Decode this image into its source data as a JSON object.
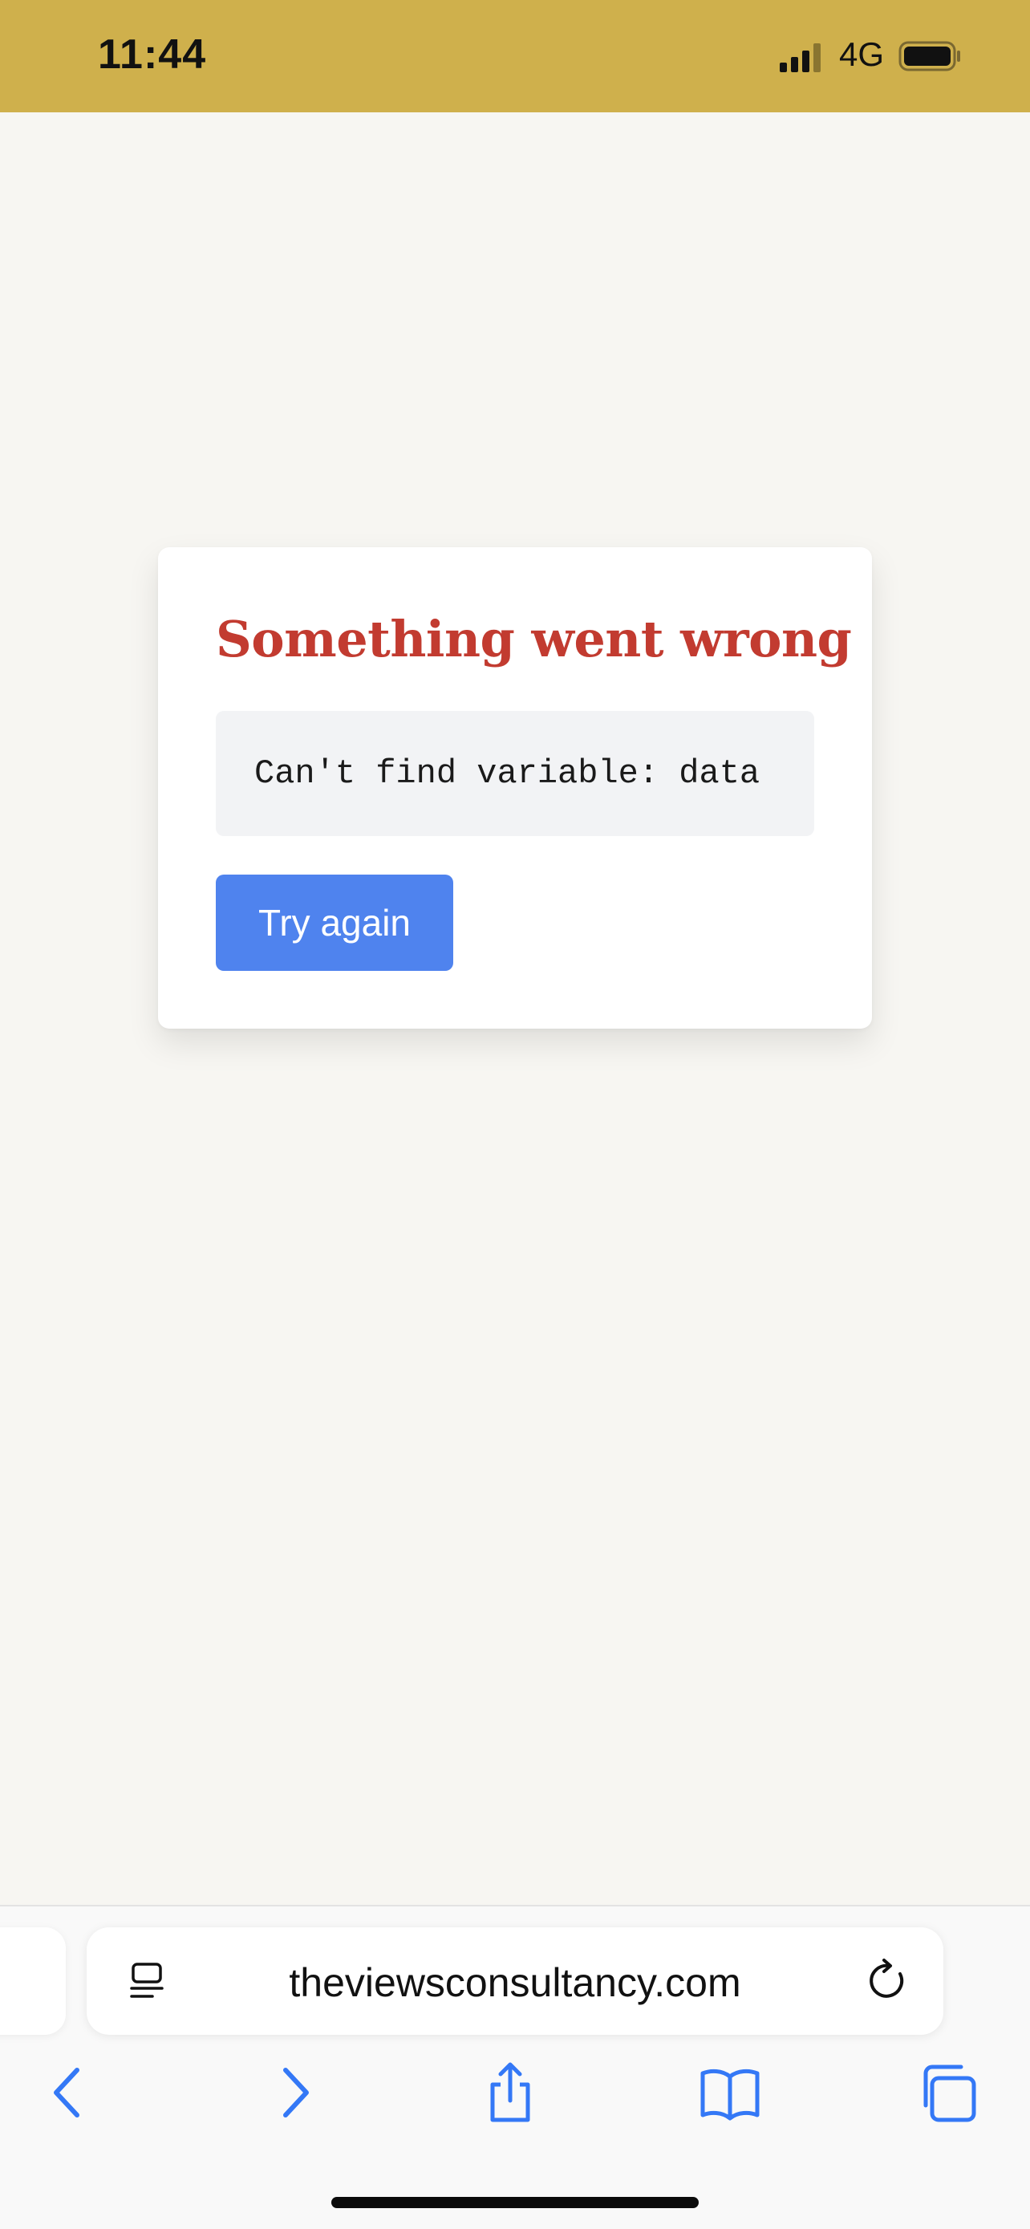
{
  "status_bar": {
    "time": "11:44",
    "network": "4G",
    "background_color": "#cfb04c"
  },
  "error_card": {
    "title": "Something went wrong",
    "message": "Can't find variable: data",
    "retry_label": "Try again",
    "title_color": "#c23b30",
    "button_color": "#4f83ee"
  },
  "browser": {
    "url": "theviewsconsultancy.com",
    "icons": [
      "reader-icon",
      "reload-icon",
      "back-icon",
      "forward-icon",
      "share-icon",
      "bookmarks-icon",
      "tabs-icon"
    ],
    "accent_color": "#3478f6"
  }
}
